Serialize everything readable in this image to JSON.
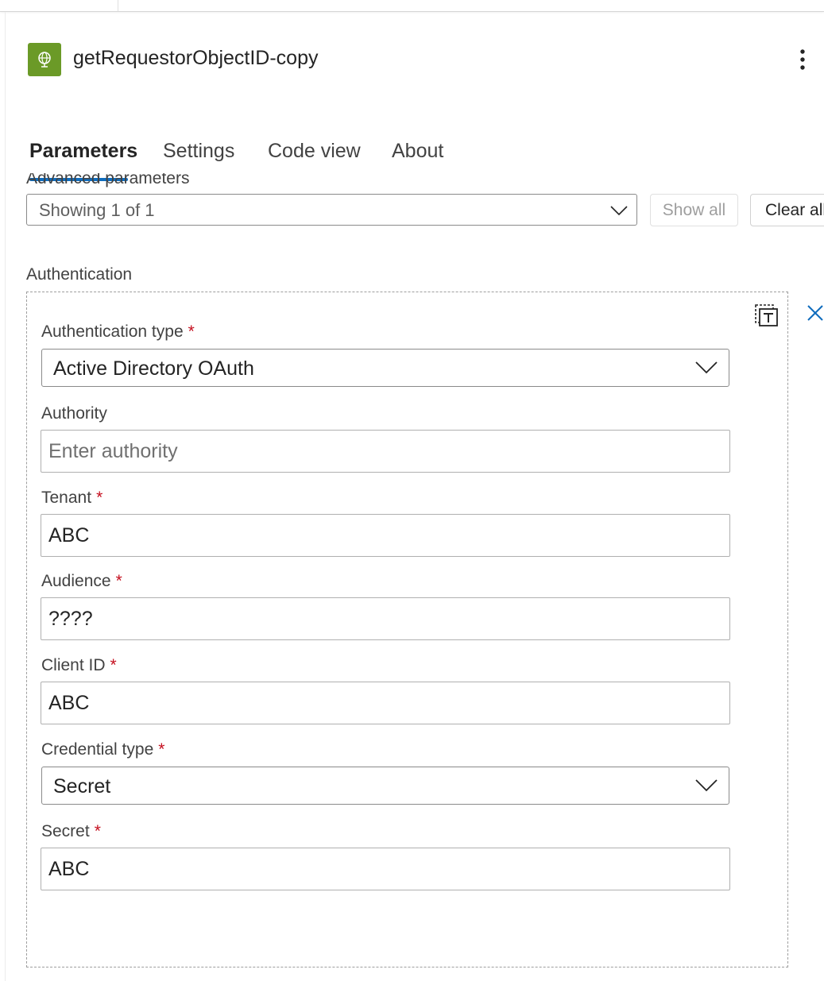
{
  "header": {
    "title": "getRequestorObjectID-copy",
    "icon": "globe-icon",
    "accent": "#6b9a27"
  },
  "tabs": [
    {
      "label": "Parameters",
      "active": true
    },
    {
      "label": "Settings",
      "active": false
    },
    {
      "label": "Code view",
      "active": false
    },
    {
      "label": "About",
      "active": false
    }
  ],
  "advanced": {
    "label": "Advanced parameters",
    "selected": "Showing 1 of 1",
    "show_all": "Show all",
    "clear_all": "Clear all"
  },
  "authentication": {
    "section_label": "Authentication",
    "required_mark": "*",
    "type": {
      "label": "Authentication type",
      "value": "Active Directory OAuth"
    },
    "authority": {
      "label": "Authority",
      "value": "",
      "placeholder": "Enter authority"
    },
    "tenant": {
      "label": "Tenant",
      "value": "ABC"
    },
    "audience": {
      "label": "Audience",
      "value": "????"
    },
    "client_id": {
      "label": "Client ID",
      "value": "ABC"
    },
    "credential_type": {
      "label": "Credential type",
      "value": "Secret"
    },
    "secret": {
      "label": "Secret",
      "value": "ABC"
    }
  },
  "colors": {
    "tab_underline": "#0f6cbd",
    "required": "#c50f1f",
    "close_icon": "#0f6cbd"
  }
}
